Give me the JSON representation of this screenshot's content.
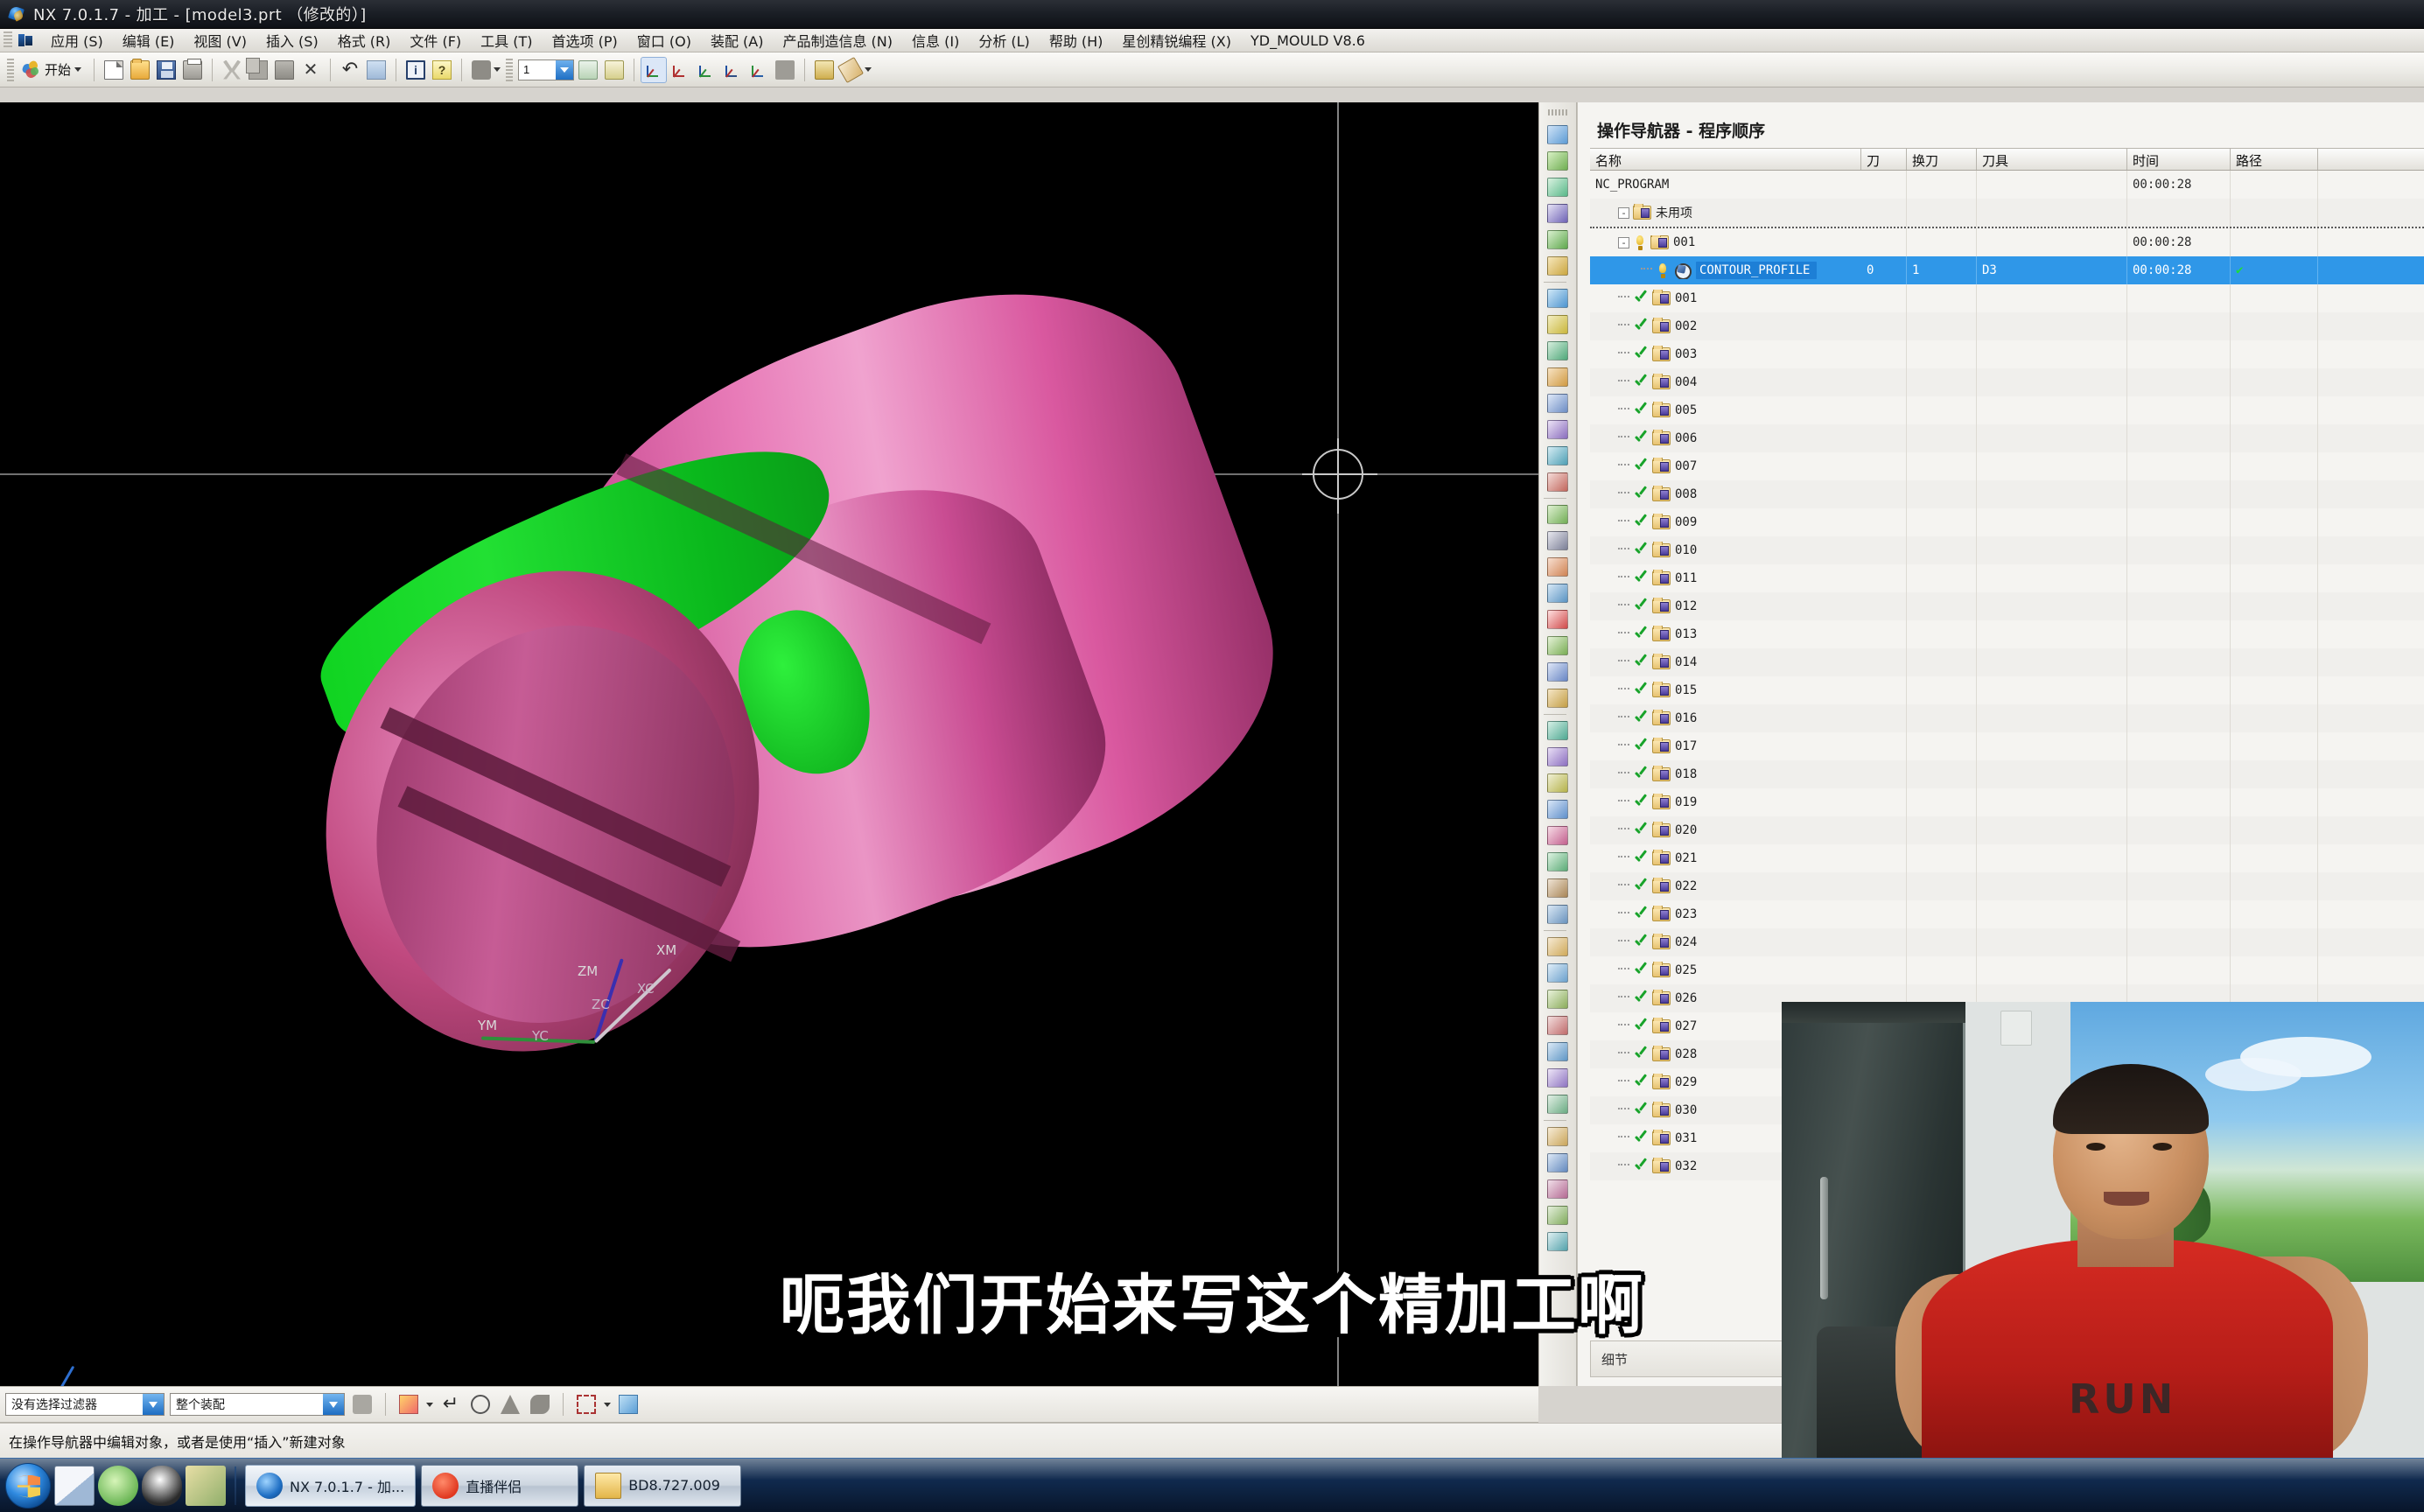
{
  "window": {
    "title": "NX 7.0.1.7 - 加工 - [model3.prt （修改的）]",
    "app_icon": "nx-logo-icon"
  },
  "menubar": {
    "items": [
      {
        "label": "应用 (S)"
      },
      {
        "label": "编辑 (E)"
      },
      {
        "label": "视图 (V)"
      },
      {
        "label": "插入 (S)"
      },
      {
        "label": "格式 (R)"
      },
      {
        "label": "文件 (F)"
      },
      {
        "label": "工具 (T)"
      },
      {
        "label": "首选项 (P)"
      },
      {
        "label": "窗口 (O)"
      },
      {
        "label": "装配 (A)"
      },
      {
        "label": "产品制造信息 (N)"
      },
      {
        "label": "信息 (I)"
      },
      {
        "label": "分析 (L)"
      },
      {
        "label": "帮助 (H)"
      },
      {
        "label": "星创精锐编程 (X)"
      },
      {
        "label": "YD_MOULD V8.6"
      }
    ]
  },
  "toolbar": {
    "start_label": "开始",
    "buttons": [
      {
        "name": "new-file-button",
        "icon": "page-icon"
      },
      {
        "name": "open-file-button",
        "icon": "folder-icon"
      },
      {
        "name": "save-button",
        "icon": "save-icon"
      },
      {
        "name": "print-button",
        "icon": "print-icon"
      },
      {
        "name": "cut-button",
        "icon": "scissors-icon"
      },
      {
        "name": "copy-button",
        "icon": "copy-icon"
      },
      {
        "name": "paste-button",
        "icon": "paste-icon"
      },
      {
        "name": "delete-button",
        "icon": "x-icon"
      },
      {
        "name": "undo-button",
        "icon": "undo-icon"
      },
      {
        "name": "redo-button",
        "icon": "redo-icon"
      },
      {
        "name": "info-button",
        "icon": "info-icon"
      },
      {
        "name": "help-button",
        "icon": "question-icon"
      }
    ],
    "layer_combo_value": "1"
  },
  "graphics": {
    "wcs_labels": [
      "ZM",
      "ZC",
      "XM",
      "XC",
      "YM",
      "YC"
    ],
    "model_colors": {
      "body": "#d85fa2",
      "body_dark": "#7d2355",
      "highlight_face": "#12c722",
      "background": "#000000"
    }
  },
  "subtitle": {
    "text": "呃我们开始来写这个精加工啊"
  },
  "navigator": {
    "title": "操作导航器 - 程序顺序",
    "columns": [
      {
        "label": "名称"
      },
      {
        "label": "刀"
      },
      {
        "label": "换刀"
      },
      {
        "label": "刀具"
      },
      {
        "label": "时间"
      },
      {
        "label": "路径"
      }
    ],
    "detail_label": "细节",
    "rows": [
      {
        "name": "NC_PROGRAM",
        "kind": "root",
        "depth": 0,
        "icon": "none",
        "tool": "",
        "change": "",
        "holder": "",
        "time": "00:00:28",
        "path": ""
      },
      {
        "name": "未用项",
        "kind": "group",
        "depth": 1,
        "icon": "folder",
        "expander": "-",
        "tool": "",
        "change": "",
        "holder": "",
        "time": "",
        "path": ""
      },
      {
        "name": "001",
        "kind": "group",
        "depth": 1,
        "icon": "folder-warn",
        "expander": "-",
        "tool": "",
        "change": "",
        "holder": "",
        "time": "00:00:28",
        "path": ""
      },
      {
        "name": "CONTOUR_PROFILE",
        "kind": "operation",
        "depth": 2,
        "icon": "operation-warn",
        "selected": true,
        "tool": "0",
        "change": "1",
        "holder": "D3",
        "time": "00:00:28",
        "path": "✔"
      },
      {
        "name": "001",
        "kind": "group",
        "depth": 1,
        "icon": "folder-check",
        "tool": "",
        "change": "",
        "holder": "",
        "time": "",
        "path": ""
      },
      {
        "name": "002",
        "kind": "group",
        "depth": 1,
        "icon": "folder-check",
        "tool": "",
        "change": "",
        "holder": "",
        "time": "",
        "path": ""
      },
      {
        "name": "003",
        "kind": "group",
        "depth": 1,
        "icon": "folder-check",
        "tool": "",
        "change": "",
        "holder": "",
        "time": "",
        "path": ""
      },
      {
        "name": "004",
        "kind": "group",
        "depth": 1,
        "icon": "folder-check",
        "tool": "",
        "change": "",
        "holder": "",
        "time": "",
        "path": ""
      },
      {
        "name": "005",
        "kind": "group",
        "depth": 1,
        "icon": "folder-check",
        "tool": "",
        "change": "",
        "holder": "",
        "time": "",
        "path": ""
      },
      {
        "name": "006",
        "kind": "group",
        "depth": 1,
        "icon": "folder-check",
        "tool": "",
        "change": "",
        "holder": "",
        "time": "",
        "path": ""
      },
      {
        "name": "007",
        "kind": "group",
        "depth": 1,
        "icon": "folder-check",
        "tool": "",
        "change": "",
        "holder": "",
        "time": "",
        "path": ""
      },
      {
        "name": "008",
        "kind": "group",
        "depth": 1,
        "icon": "folder-check",
        "tool": "",
        "change": "",
        "holder": "",
        "time": "",
        "path": ""
      },
      {
        "name": "009",
        "kind": "group",
        "depth": 1,
        "icon": "folder-check",
        "tool": "",
        "change": "",
        "holder": "",
        "time": "",
        "path": ""
      },
      {
        "name": "010",
        "kind": "group",
        "depth": 1,
        "icon": "folder-check",
        "tool": "",
        "change": "",
        "holder": "",
        "time": "",
        "path": ""
      },
      {
        "name": "011",
        "kind": "group",
        "depth": 1,
        "icon": "folder-check",
        "tool": "",
        "change": "",
        "holder": "",
        "time": "",
        "path": ""
      },
      {
        "name": "012",
        "kind": "group",
        "depth": 1,
        "icon": "folder-check",
        "tool": "",
        "change": "",
        "holder": "",
        "time": "",
        "path": ""
      },
      {
        "name": "013",
        "kind": "group",
        "depth": 1,
        "icon": "folder-check",
        "tool": "",
        "change": "",
        "holder": "",
        "time": "",
        "path": ""
      },
      {
        "name": "014",
        "kind": "group",
        "depth": 1,
        "icon": "folder-check",
        "tool": "",
        "change": "",
        "holder": "",
        "time": "",
        "path": ""
      },
      {
        "name": "015",
        "kind": "group",
        "depth": 1,
        "icon": "folder-check",
        "tool": "",
        "change": "",
        "holder": "",
        "time": "",
        "path": ""
      },
      {
        "name": "016",
        "kind": "group",
        "depth": 1,
        "icon": "folder-check",
        "tool": "",
        "change": "",
        "holder": "",
        "time": "",
        "path": ""
      },
      {
        "name": "017",
        "kind": "group",
        "depth": 1,
        "icon": "folder-check",
        "tool": "",
        "change": "",
        "holder": "",
        "time": "",
        "path": ""
      },
      {
        "name": "018",
        "kind": "group",
        "depth": 1,
        "icon": "folder-check",
        "tool": "",
        "change": "",
        "holder": "",
        "time": "",
        "path": ""
      },
      {
        "name": "019",
        "kind": "group",
        "depth": 1,
        "icon": "folder-check",
        "tool": "",
        "change": "",
        "holder": "",
        "time": "",
        "path": ""
      },
      {
        "name": "020",
        "kind": "group",
        "depth": 1,
        "icon": "folder-check",
        "tool": "",
        "change": "",
        "holder": "",
        "time": "",
        "path": ""
      },
      {
        "name": "021",
        "kind": "group",
        "depth": 1,
        "icon": "folder-check",
        "tool": "",
        "change": "",
        "holder": "",
        "time": "",
        "path": ""
      },
      {
        "name": "022",
        "kind": "group",
        "depth": 1,
        "icon": "folder-check",
        "tool": "",
        "change": "",
        "holder": "",
        "time": "",
        "path": ""
      },
      {
        "name": "023",
        "kind": "group",
        "depth": 1,
        "icon": "folder-check",
        "tool": "",
        "change": "",
        "holder": "",
        "time": "",
        "path": ""
      },
      {
        "name": "024",
        "kind": "group",
        "depth": 1,
        "icon": "folder-check",
        "tool": "",
        "change": "",
        "holder": "",
        "time": "",
        "path": ""
      },
      {
        "name": "025",
        "kind": "group",
        "depth": 1,
        "icon": "folder-check",
        "tool": "",
        "change": "",
        "holder": "",
        "time": "",
        "path": ""
      },
      {
        "name": "026",
        "kind": "group",
        "depth": 1,
        "icon": "folder-check",
        "tool": "",
        "change": "",
        "holder": "",
        "time": "",
        "path": ""
      },
      {
        "name": "027",
        "kind": "group",
        "depth": 1,
        "icon": "folder-check",
        "tool": "",
        "change": "",
        "holder": "",
        "time": "",
        "path": ""
      },
      {
        "name": "028",
        "kind": "group",
        "depth": 1,
        "icon": "folder-check",
        "tool": "",
        "change": "",
        "holder": "",
        "time": "",
        "path": ""
      },
      {
        "name": "029",
        "kind": "group",
        "depth": 1,
        "icon": "folder-check",
        "tool": "",
        "change": "",
        "holder": "",
        "time": "",
        "path": ""
      },
      {
        "name": "030",
        "kind": "group",
        "depth": 1,
        "icon": "folder-check",
        "tool": "",
        "change": "",
        "holder": "",
        "time": "",
        "path": ""
      },
      {
        "name": "031",
        "kind": "group",
        "depth": 1,
        "icon": "folder-check",
        "tool": "",
        "change": "",
        "holder": "",
        "time": "",
        "path": ""
      },
      {
        "name": "032",
        "kind": "group",
        "depth": 1,
        "icon": "folder-check",
        "tool": "",
        "change": "",
        "holder": "",
        "time": "",
        "path": ""
      }
    ]
  },
  "selection_bar": {
    "filter_value": "没有选择过滤器",
    "scope_value": "整个装配"
  },
  "statusbar": {
    "message": "在操作导航器中编辑对象，或者是使用“插入”新建对象"
  },
  "taskbar": {
    "start_name": "windows-start-button",
    "quick_launch": [
      {
        "name": "quick-launch-notepad-icon"
      },
      {
        "name": "quick-launch-browser-icon"
      },
      {
        "name": "quick-launch-qq-icon"
      },
      {
        "name": "quick-launch-editor-icon"
      }
    ],
    "buttons": [
      {
        "label": "NX 7.0.1.7 - 加...",
        "icon": "nx-logo-icon",
        "active": true
      },
      {
        "label": "直播伴侣",
        "icon": "live-companion-icon",
        "active": false
      },
      {
        "label": "BD8.727.009",
        "icon": "folder-icon",
        "active": false
      }
    ]
  },
  "webcam": {
    "shirt_text": "RUN"
  }
}
